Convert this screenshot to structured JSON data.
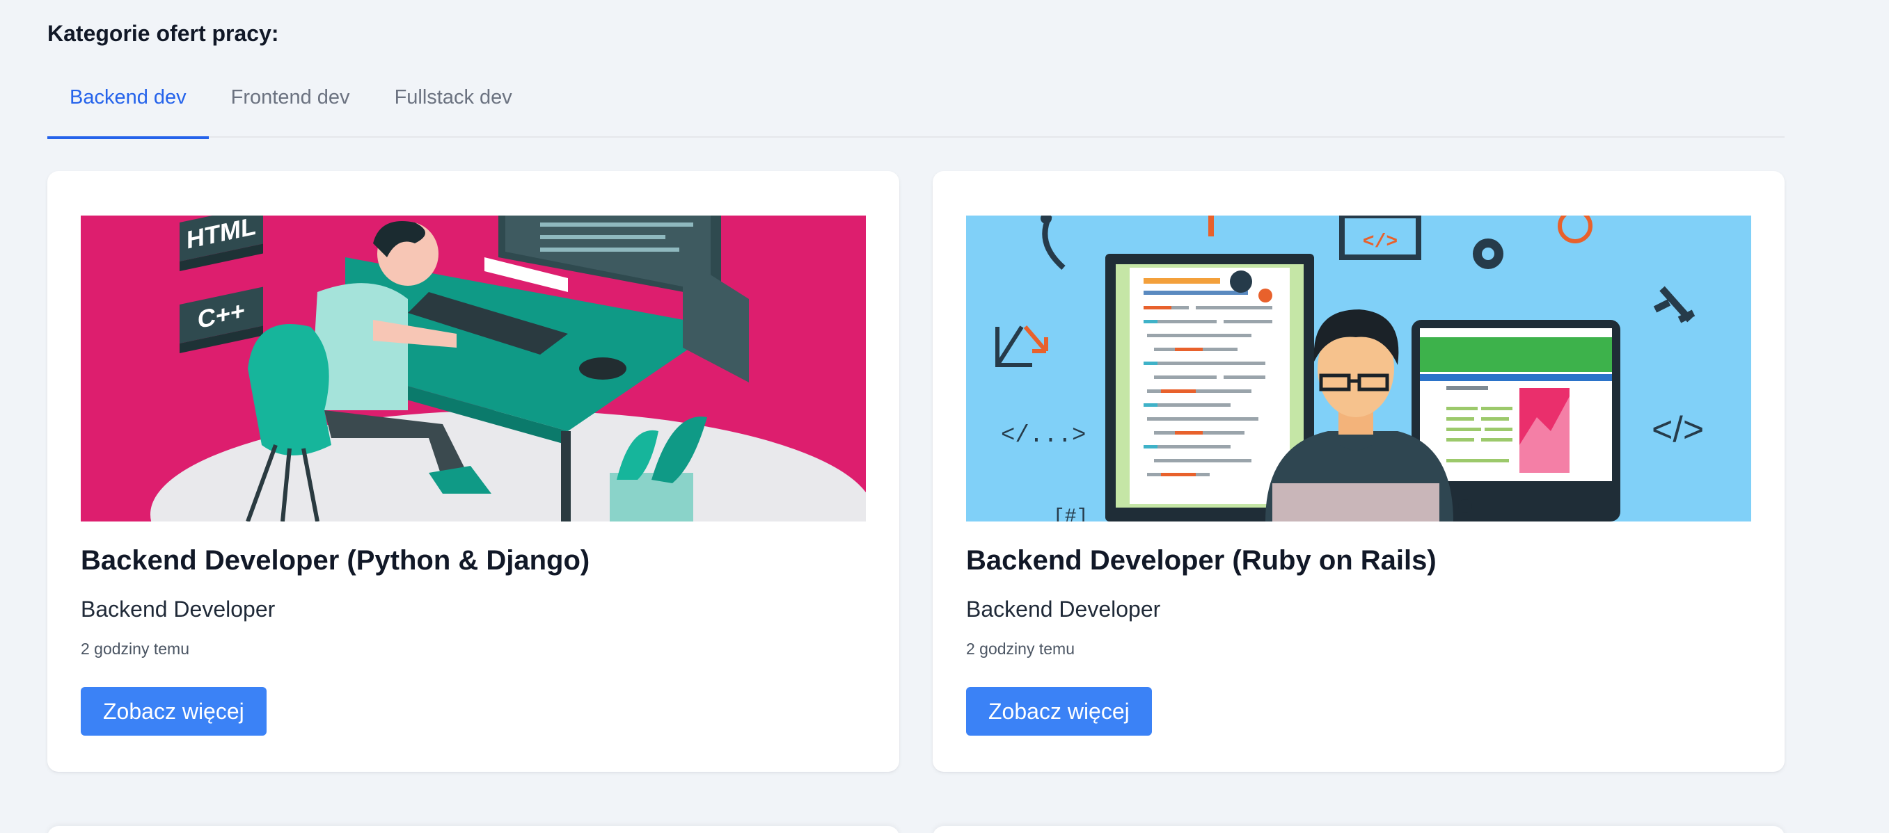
{
  "section": {
    "title": "Kategorie ofert pracy:"
  },
  "tabs": [
    {
      "label": "Backend dev",
      "active": true
    },
    {
      "label": "Frontend dev",
      "active": false
    },
    {
      "label": "Fullstack dev",
      "active": false
    }
  ],
  "colors": {
    "accent": "#2563eb",
    "button": "#3b82f6",
    "card1_image_bg": "#dd1e6e",
    "card2_image_bg": "#80d0f8"
  },
  "cards": [
    {
      "image": "developer-at-desk-illustration",
      "image_texts": [
        "HTML",
        "C++"
      ],
      "title": "Backend Developer (Python & Django)",
      "subtitle": "Backend Developer",
      "time": "2 godziny temu",
      "button": "Zobacz więcej"
    },
    {
      "image": "developer-with-laptop-illustration",
      "image_texts": [
        "</>",
        "</...>",
        "</>",
        "[#]"
      ],
      "title": "Backend Developer (Ruby on Rails)",
      "subtitle": "Backend Developer",
      "time": "2 godziny temu",
      "button": "Zobacz więcej"
    }
  ]
}
